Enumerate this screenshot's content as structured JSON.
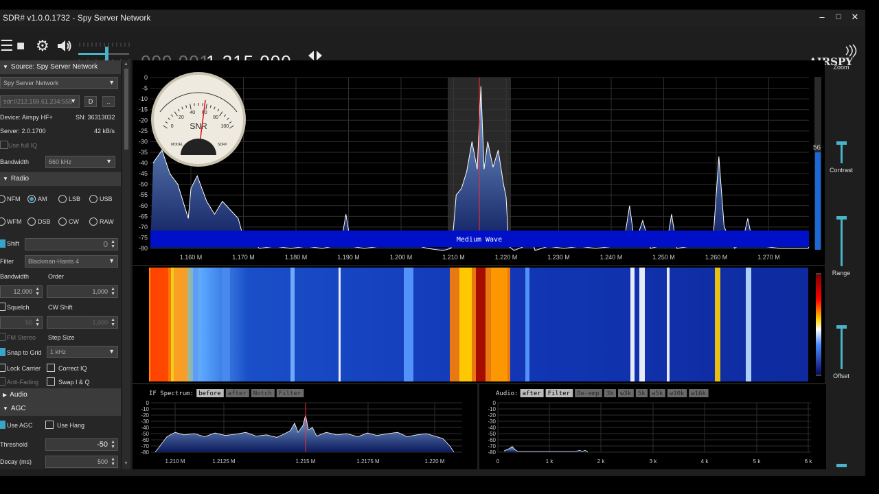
{
  "window": {
    "title": "SDR# v1.0.0.1732 - Spy Server Network",
    "minimize": "–",
    "maximize": "□",
    "close": "✕"
  },
  "toolbar": {
    "menu_icon": "☰",
    "stop_icon": "■",
    "settings_icon": "⚙",
    "volume_icon": "🔈",
    "frequency_dim": "000.001",
    "frequency_bright": "1.215.000",
    "tune_icon": "◀▶",
    "logo": "AIRSPY"
  },
  "source": {
    "header": "Source: Spy Server Network",
    "type_select": "Spy Server Network",
    "uri": "sdr://212.159.61.234:555",
    "btn_d": "D",
    "btn_more": "..",
    "device": "Device: Airspy HF+",
    "sn": "SN: 36313032",
    "server": "Server: 2.0.1700",
    "rate": "42 kB/s",
    "use_full_iq": "Use full IQ",
    "bandwidth_label": "Bandwidth",
    "bandwidth_value": "660 kHz"
  },
  "radio": {
    "header": "Radio",
    "modes": [
      "NFM",
      "AM",
      "LSB",
      "USB",
      "WFM",
      "DSB",
      "CW",
      "RAW"
    ],
    "selected_mode": "AM",
    "shift_label": "Shift",
    "shift_value": "0",
    "filter_label": "Filter",
    "filter_value": "Blackman-Harris 4",
    "bandwidth_label": "Bandwidth",
    "order_label": "Order",
    "bandwidth_value": "12,000",
    "order_value": "1,000",
    "squelch_label": "Squelch",
    "cw_shift_label": "CW Shift",
    "squelch_value": "50",
    "cw_shift_value": "1,000",
    "fm_stereo": "FM Stereo",
    "step_size_label": "Step Size",
    "snap_to_grid": "Snap to Grid",
    "step_size_value": "1 kHz",
    "lock_carrier": "Lock Carrier",
    "correct_iq": "Correct IQ",
    "anti_fading": "Anti-Fading",
    "swap_iq": "Swap I & Q"
  },
  "audio": {
    "header": "Audio"
  },
  "agc": {
    "header": "AGC",
    "use_agc": "Use AGC",
    "use_hang": "Use Hang",
    "threshold_label": "Threshold",
    "threshold_value": "-50",
    "decay_label": "Decay (ms)",
    "decay_value": "500"
  },
  "right_controls": {
    "zoom": "Zoom",
    "contrast": "Contrast",
    "range": "Range",
    "offset": "Offset",
    "level_readout": "56"
  },
  "spectrum": {
    "y_ticks": [
      "0",
      "-5",
      "-10",
      "-15",
      "-20",
      "-25",
      "-30",
      "-35",
      "-40",
      "-45",
      "-50",
      "-55",
      "-60",
      "-65",
      "-70",
      "-75",
      "-80"
    ],
    "x_ticks": [
      "1.160 M",
      "1.170 M",
      "1.180 M",
      "1.190 M",
      "1.200 M",
      "1.210 M",
      "1.220 M",
      "1.230 M",
      "1.240 M",
      "1.250 M",
      "1.260 M",
      "1.270 M"
    ],
    "band_label": "Medium Wave",
    "meter_label": "SNR",
    "meter_ticks": [
      "0",
      "20",
      "40",
      "60",
      "80",
      "100"
    ],
    "meter_model": "MODEL",
    "meter_brand": "SDR#"
  },
  "if_spectrum": {
    "title": "IF Spectrum:",
    "buttons": [
      "before",
      "after",
      "Notch",
      "Filter"
    ],
    "y_ticks": [
      "0",
      "-10",
      "-20",
      "-30",
      "-40",
      "-50",
      "-60",
      "-70",
      "-80"
    ],
    "x_ticks": [
      "1.210 M",
      "1.2125 M",
      "1.215 M",
      "1.2175 M",
      "1.220 M"
    ]
  },
  "audio_spectrum": {
    "title": "Audio:",
    "buttons": [
      "after",
      "Filter",
      "De-emp",
      "3k",
      "w3k",
      "5k",
      "w5k",
      "w10k",
      "w16k"
    ],
    "y_ticks": [
      "0",
      "-10",
      "-20",
      "-30",
      "-40",
      "-50",
      "-60",
      "-70",
      "-80"
    ],
    "x_ticks": [
      "0",
      "1 k",
      "2 k",
      "3 k",
      "4 k",
      "5 k",
      "6 k"
    ]
  },
  "colors": {
    "accent": "#3aa3c8",
    "trace": "#ffffff",
    "fill_top": "#7fa7d8",
    "fill_bottom": "#0c1a5c",
    "band": "#0010c8",
    "marker": "#ff2a2a"
  }
}
